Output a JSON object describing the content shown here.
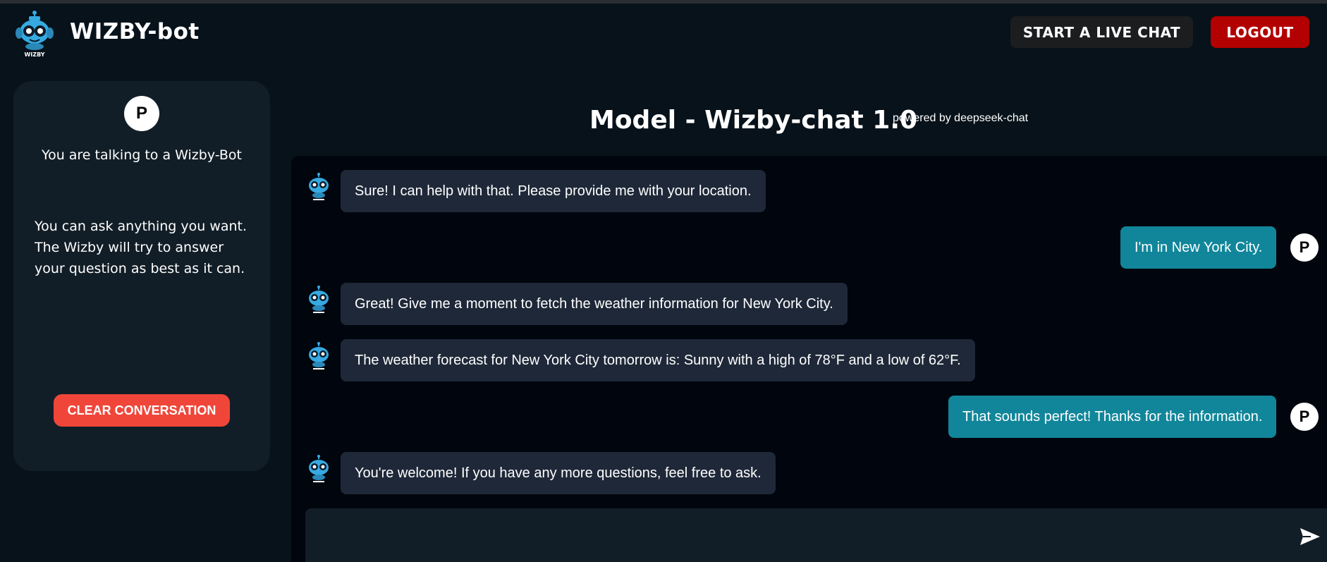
{
  "header": {
    "brand": "WIZBY-bot",
    "logo_text": "WIZBY",
    "live_chat_label": "START A LIVE CHAT",
    "logout_label": "LOGOUT"
  },
  "sidebar": {
    "avatar_initial": "P",
    "title": "You are talking to a Wizby-Bot",
    "description": "You can ask anything you want. The Wizby will try to answer your question as best as it can.",
    "clear_label": "CLEAR CONVERSATION"
  },
  "main": {
    "model_title": "Model - Wizby-chat 1.0",
    "powered_by": "powered by deepseek-chat"
  },
  "messages": [
    {
      "role": "bot",
      "text": "Sure! I can help with that. Please provide me with your location."
    },
    {
      "role": "user",
      "text": "I'm in New York City.",
      "avatar": "P"
    },
    {
      "role": "bot",
      "text": "Great! Give me a moment to fetch the weather information for New York City."
    },
    {
      "role": "bot",
      "text": "The weather forecast for New York City tomorrow is: Sunny with a high of 78°F and a low of 62°F."
    },
    {
      "role": "user",
      "text": "That sounds perfect! Thanks for the information.",
      "avatar": "P"
    },
    {
      "role": "bot",
      "text": "You're welcome! If you have any more questions, feel free to ask."
    }
  ],
  "input": {
    "value": "",
    "placeholder": ""
  },
  "icons": {
    "logo": "robot-logo-icon",
    "bot_avatar": "robot-avatar-icon",
    "send": "send-icon"
  },
  "colors": {
    "background": "#07121a",
    "sidebar": "#121e27",
    "chat_bg": "#01050d",
    "bot_bubble": "#1e2838",
    "user_bubble": "#11869a",
    "logout": "#b30000",
    "clear": "#f0463a",
    "accent_robot": "#36a9e1"
  }
}
